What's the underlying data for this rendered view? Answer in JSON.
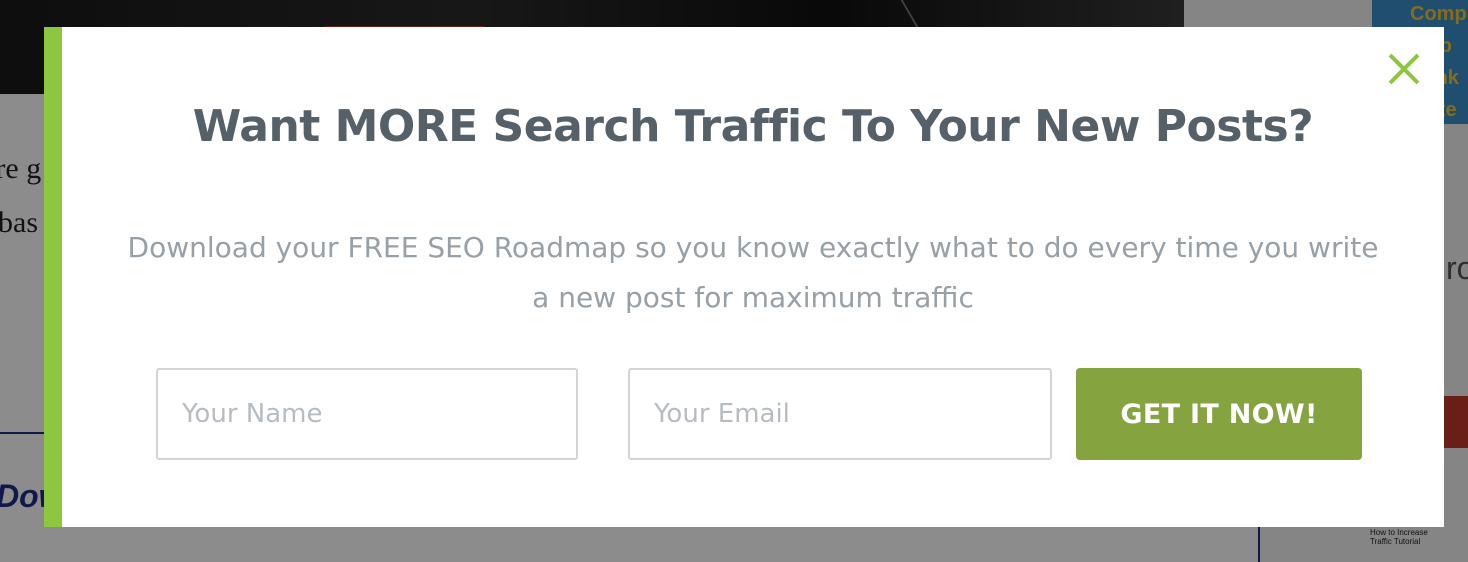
{
  "background": {
    "text_line_1": "'re g",
    "text_line_2": "bas",
    "box_text": "Dow",
    "sidebar_partial": "ro",
    "sidebar_banner_text": "Comp Web Rank Faite",
    "sidebar_small_text": "How to Increase Traffic Tutorial"
  },
  "modal": {
    "headline": "Want MORE Search Traffic To Your New Posts?",
    "subheadline": "Download your FREE SEO Roadmap so you know exactly what to do every time you write a new post for maximum traffic",
    "name_placeholder": "Your Name",
    "email_placeholder": "Your Email",
    "submit_label": "GET IT NOW!",
    "close_icon": "close-icon"
  },
  "colors": {
    "accent_bar": "#8dc63f",
    "button": "#85a33f",
    "close_icon": "#8dc63f",
    "headline": "#566069",
    "subheadline": "#97a0a7"
  }
}
